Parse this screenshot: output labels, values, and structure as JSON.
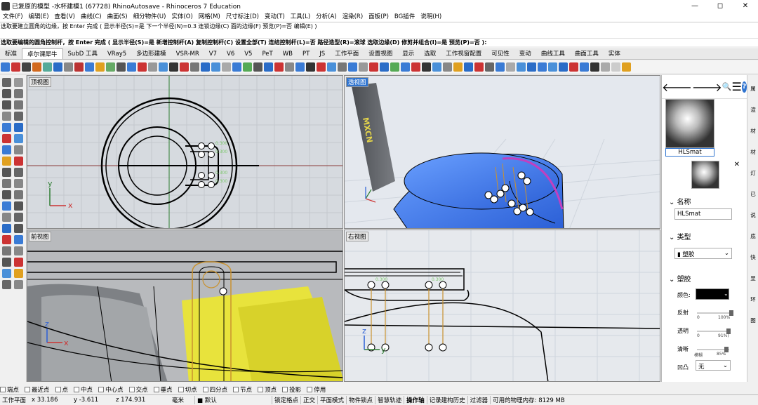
{
  "window": {
    "title": "已复原的模型 -水杯建模1 (67728) RhinoAutosave - Rhinoceros 7 Education",
    "minimize": "—",
    "restore": "◻",
    "close": "✕"
  },
  "menu": [
    "文件(F)",
    "编辑(E)",
    "查看(V)",
    "曲线(C)",
    "曲面(S)",
    "细分物件(U)",
    "实体(O)",
    "网格(M)",
    "尺寸标注(D)",
    "变动(T)",
    "工具(L)",
    "分析(A)",
    "渲染(R)",
    "面板(P)",
    "BG插件",
    "说明(H)"
  ],
  "command": {
    "line1": "选取要建立圆角的边缘，按 Enter 完成 ( 显示半径(S)=是  下一个半径(N)=0.3  连锁边缘(C)  面的边缘(F)  预览(P)=否  编辑(E) )",
    "line2": "",
    "line3": "选取要编辑的圆角控制杆，按 Enter 完成 ( 显示半径(S)=是  新增控制杆(A)  复制控制杆(C)  设置全部(T)  连结控制杆(L)=否  路径造型(R)=滚球  选取边缘(D)  修剪并组合(I)=是  预览(P)=否 ):"
  },
  "tabs": [
    "标准",
    "卓尔课犀牛",
    "SubD 工具",
    "VRay5",
    "多边形建模",
    "VSR-MR",
    "V7",
    "V6",
    "V5",
    "PeT",
    "WB",
    "PT",
    "JS",
    "工作平面",
    "设置视图",
    "显示",
    "选取",
    "工作视窗配置",
    "可见性",
    "变动",
    "曲线工具",
    "曲面工具",
    "实体"
  ],
  "active_tab": "卓尔课犀牛",
  "viewports": {
    "top": "顶视图",
    "perspective": "透视图",
    "front": "前视图",
    "right": "右视图"
  },
  "axes": {
    "x": "x",
    "y": "y",
    "z": "z"
  },
  "scene": {
    "persp_logo": "MXCN",
    "fillet_label": "0.300"
  },
  "panel": {
    "nav": {
      "back": "🡐",
      "forward": "🡒",
      "search": "🔍",
      "menu": "☰",
      "help": "?"
    },
    "material_name": "HLSmat",
    "close": "✕",
    "name_section": "名称",
    "name_value": "HLSmat",
    "type_section": "类型",
    "type_value": "塑胶",
    "plastic_section": "塑胶",
    "color_label": "颜色:",
    "color_value": "#000000",
    "reflect_label": "反射",
    "reflect_min": "0",
    "reflect_max": "100%",
    "reflect_level": 1.0,
    "transparency_label": "透明",
    "trans_min": "0",
    "trans_max": "91%)",
    "trans_level": 0.91,
    "clarity_label": "清晰",
    "clarity_min": "模糊",
    "clarity_max": "85%",
    "clarity_level": 0.85,
    "bump_label": "凹凸",
    "bump_value": "无"
  },
  "right_strip": [
    "属",
    "渲",
    "材",
    "材",
    "灯",
    "已",
    "说",
    "底",
    "快",
    "显",
    "环",
    "图"
  ],
  "osnap": [
    "端点",
    "最近点",
    "点",
    "中点",
    "中心点",
    "交点",
    "垂点",
    "切点",
    "四分点",
    "节点",
    "顶点",
    "投影",
    "停用"
  ],
  "status": {
    "cplane": "工作平面",
    "x": "x 33.186",
    "y": "y -3.611",
    "z": "z 174.931",
    "unit": "毫米",
    "layer": "默认",
    "items": [
      "锁定格点",
      "正交",
      "平面模式",
      "物件锁点",
      "智慧轨迹",
      "操作轴",
      "记录建构历史",
      "过滤器"
    ],
    "memory": "可用的物理内存: 8129 MB"
  }
}
